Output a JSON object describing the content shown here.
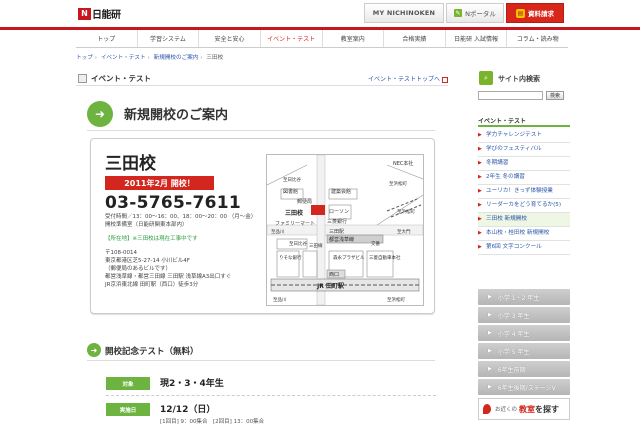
{
  "header": {
    "logo_mark": "N",
    "logo_text": "日能研",
    "my_nichinoken": "MY NICHINOKEN",
    "n_portal": "Nポータル",
    "shiryo": "資料請求"
  },
  "nav": [
    {
      "label": "トップ",
      "active": false
    },
    {
      "label": "学習システム",
      "active": false
    },
    {
      "label": "安全と安心",
      "active": false
    },
    {
      "label": "イベント・テスト",
      "active": true
    },
    {
      "label": "教室案内",
      "active": false
    },
    {
      "label": "合格実績",
      "active": false
    },
    {
      "label": "日能研 入試情報",
      "active": false
    },
    {
      "label": "コラム・読み物",
      "active": false
    }
  ],
  "breadcrumb": [
    "トップ",
    "イベント・テスト",
    "新規開校のご案内",
    "三田校"
  ],
  "page_title": "イベント・テスト",
  "page_title_link": "イベント・テストトップへ",
  "main_heading": "新規開校のご案内",
  "school": {
    "name": "三田校",
    "badge": "2011年2月 開校！",
    "phone": "03-5765-7611",
    "hours": "受付時間／13：00〜16：00、18：00〜20：00 （月〜金）",
    "office": "開校準備室（日能研関東本部内）",
    "note_label": "【所在地】",
    "note": "※三田校は現在工事中です",
    "postal": "〒108-0014",
    "address": "東京都港区芝5-27-14 小川ビル4F",
    "address_note": "（郵便局のあるビルです）",
    "access1": "都営浅草線・都営三田線 三田駅 浅草線A3出口すぐ",
    "access2": "JR京浜東北線 田町駅（西口）徒歩3分"
  },
  "map": {
    "labels": [
      "NEC本社",
      "図書館",
      "建築会館",
      "郵便局",
      "三田校",
      "ローソン",
      "ファミリーマート",
      "三菱銀行",
      "三田駅",
      "至品川",
      "都営浅草線",
      "三田線",
      "りそな銀行",
      "森永プラザビル",
      "三菱自動車本社",
      "西口",
      "JR 田町駅",
      "至品川",
      "至浜松町",
      "至大門",
      "至日比谷",
      "至浜松町",
      "至日比谷",
      "至浜松町",
      "交番"
    ]
  },
  "commemorative": {
    "title": "開校記念テスト（無料）",
    "row1_tag": "対象",
    "row1_value": "現2・3・4年生",
    "row2_tag": "実施日",
    "row2_value": "12/12（日）",
    "row2_sub": "[1回目] 9：00集合　[2回目] 13：00集合"
  },
  "sidebar": {
    "search_heading": "サイト内検索",
    "search_button": "検索",
    "category": "イベント・テスト",
    "items": [
      "学力チャレンジテスト",
      "学びのフェスティバル",
      "冬期講習",
      "2年生 冬の講習",
      "ユーリカ！きっず体験授業",
      "リーダーカをどう育てるか(5)",
      "三田校 新規開校",
      "本山校・桂田校 新規開校",
      "第6回 文字コンクール"
    ],
    "grades": [
      "小学 1・2 年生",
      "小学 3 年生",
      "小学 4 年生",
      "小学 5 年生",
      "6年生前期",
      "6年生後期/ステージV"
    ],
    "near_small": "お近くの",
    "near_red": "教室",
    "near_rest": "を探す"
  },
  "colors": {
    "brand_red": "#c8161e",
    "accent_green": "#6db33f",
    "link_blue": "#2a55a8"
  }
}
